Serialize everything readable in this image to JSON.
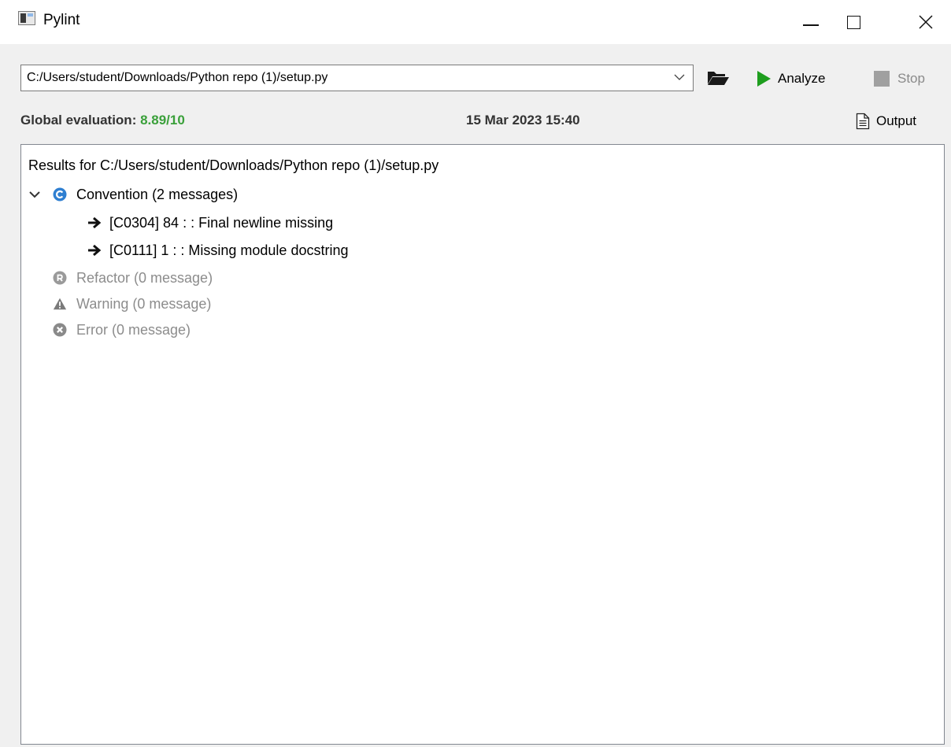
{
  "window": {
    "title": "Pylint",
    "minimize_label": "Minimize",
    "maximize_label": "Maximize",
    "close_label": "Close"
  },
  "toolbar": {
    "path_value": "C:/Users/student/Downloads/Python repo (1)/setup.py",
    "analyze_label": "Analyze",
    "stop_label": "Stop",
    "output_label": "Output"
  },
  "evaluation": {
    "label": "Global evaluation:",
    "score": "8.89/10",
    "date": "15 Mar 2023 15:40"
  },
  "results": {
    "header": "Results for C:/Users/student/Downloads/Python repo (1)/setup.py",
    "categories": [
      {
        "label": "Convention (2 messages)",
        "icon": "convention-icon",
        "expanded": true,
        "messages": [
          {
            "label": "[C0304] 84 : : Final newline missing"
          },
          {
            "label": "[C0111] 1 : : Missing module docstring"
          }
        ]
      },
      {
        "label": "Refactor (0 message)",
        "icon": "refactor-icon"
      },
      {
        "label": "Warning (0 message)",
        "icon": "warning-icon"
      },
      {
        "label": "Error (0 message)",
        "icon": "error-icon"
      }
    ]
  },
  "colors": {
    "score_green": "#3aa03a",
    "analyze_green": "#1e9e1e",
    "convention_blue": "#2f7fd1",
    "disabled_gray": "#8c8c8c"
  }
}
